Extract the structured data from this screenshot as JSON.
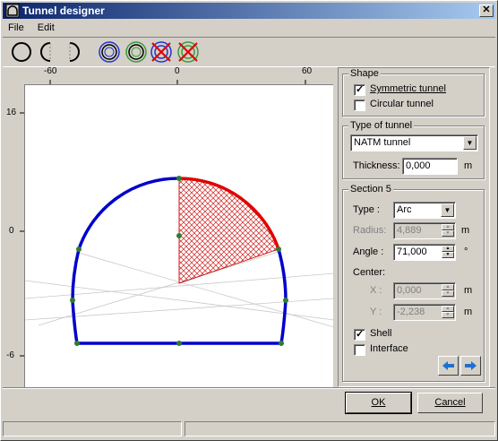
{
  "window": {
    "title": "Tunnel designer",
    "close_glyph": "✕"
  },
  "menu": [
    "File",
    "Edit"
  ],
  "toolbar": [
    "full-circle-icon",
    "left-arc-icon",
    "right-arc-icon",
    "double-circle-icon",
    "double-circle-alt-icon",
    "delete-circle-icon",
    "delete-circle-alt-icon"
  ],
  "rulers": {
    "top": [
      "-60",
      "0",
      "60"
    ],
    "left": [
      "16",
      "0",
      "-6"
    ]
  },
  "shape": {
    "group_label": "Shape",
    "symmetric_label": "Symmetric tunnel",
    "symmetric_checked": true,
    "circular_label": "Circular tunnel",
    "circular_checked": false
  },
  "tunnel_type": {
    "group_label": "Type of tunnel",
    "selected": "NATM tunnel",
    "thickness_label": "Thickness:",
    "thickness_value": "0,000",
    "thickness_unit": "m"
  },
  "section": {
    "group_label": "Section 5",
    "type_label": "Type :",
    "type_value": "Arc",
    "radius_label": "Radius:",
    "radius_value": "4,889",
    "radius_unit": "m",
    "angle_label": "Angle :",
    "angle_value": "71,000",
    "angle_unit": "°",
    "center_label": "Center:",
    "x_label": "X :",
    "x_value": "0,000",
    "x_unit": "m",
    "y_label": "Y :",
    "y_value": "-2,238",
    "y_unit": "m",
    "shell_label": "Shell",
    "shell_checked": true,
    "interface_label": "Interface",
    "interface_checked": false
  },
  "buttons": {
    "ok": "OK",
    "cancel": "Cancel"
  },
  "colors": {
    "lining": "#0000cc",
    "selected_section": "#e00000",
    "node": "#2e7d32",
    "title_start": "#0a246a",
    "title_end": "#a6caf0"
  }
}
